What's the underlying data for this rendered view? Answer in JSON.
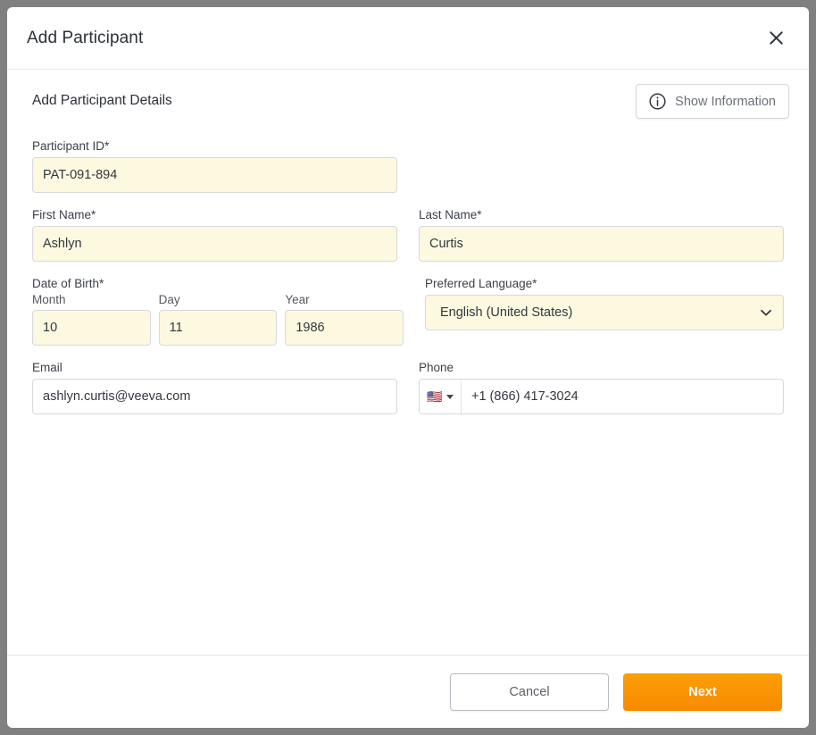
{
  "dialog": {
    "title": "Add Participant",
    "close_icon": "close-icon"
  },
  "section": {
    "heading": "Add Participant Details",
    "show_information_label": "Show Information",
    "info_icon": "info-circle-icon"
  },
  "form": {
    "participant_id": {
      "label": "Participant ID*",
      "value": "PAT-091-894",
      "placeholder": ""
    },
    "first_name": {
      "label": "First Name*",
      "value": "Ashlyn",
      "placeholder": ""
    },
    "last_name": {
      "label": "Last Name*",
      "value": "Curtis",
      "placeholder": ""
    },
    "date_of_birth": {
      "label": "Date of Birth*",
      "month": {
        "label": "Month",
        "value": "10",
        "placeholder": ""
      },
      "day": {
        "label": "Day",
        "value": "11",
        "placeholder": ""
      },
      "year": {
        "label": "Year",
        "value": "1986",
        "placeholder": ""
      }
    },
    "preferred_language": {
      "label": "Preferred Language*",
      "value": "English (United States)",
      "chevron_icon": "chevron-down-icon"
    },
    "email": {
      "label": "Email",
      "value": "ashlyn.curtis@veeva.com",
      "placeholder": ""
    },
    "phone": {
      "label": "Phone",
      "country_flag": "🇺🇸",
      "country_flag_icon": "us-flag-icon",
      "caret_icon": "caret-down-icon",
      "value": "+1 (866) 417-3024",
      "placeholder": ""
    }
  },
  "footer": {
    "cancel_label": "Cancel",
    "next_label": "Next"
  },
  "colors": {
    "accent_orange": "#F99300",
    "required_field_fill": "#FCF9E0",
    "backdrop": "#808080",
    "border": "#D6D9DE"
  }
}
